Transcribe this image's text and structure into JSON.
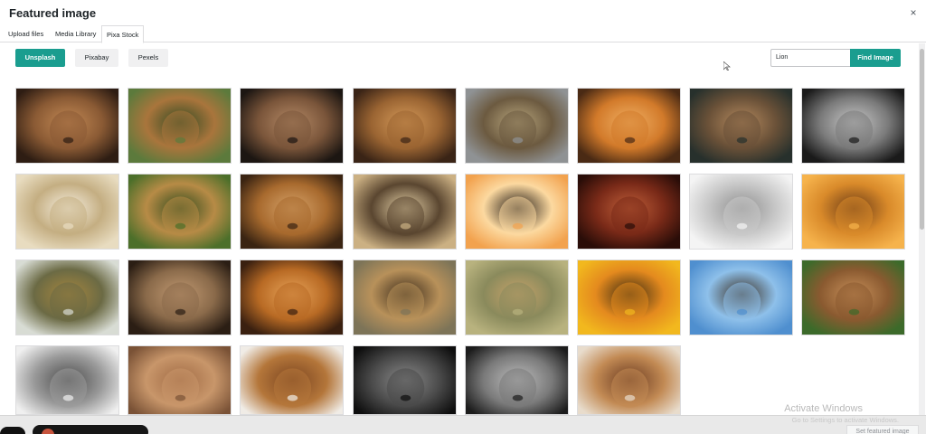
{
  "modal": {
    "title": "Featured image",
    "close_symbol": "×"
  },
  "tabs": [
    {
      "label": "Upload files",
      "active": false
    },
    {
      "label": "Media Library",
      "active": false
    },
    {
      "label": "Pixa Stock",
      "active": true
    }
  ],
  "sources": [
    {
      "label": "Unsplash",
      "active": true
    },
    {
      "label": "Pixabay",
      "active": false
    },
    {
      "label": "Pexels",
      "active": false
    }
  ],
  "search": {
    "value": "Lion",
    "button_label": "Find Image"
  },
  "results": [
    {
      "name": "lion-portrait-dark-mane",
      "colors": [
        "#2e1d13",
        "#8a5a34",
        "#c48a55"
      ]
    },
    {
      "name": "lion-walking-grass",
      "colors": [
        "#5c7a3c",
        "#a9753c",
        "#2f4a22"
      ]
    },
    {
      "name": "lion-profile-shadow",
      "colors": [
        "#1c1612",
        "#7a553a",
        "#b58a66"
      ]
    },
    {
      "name": "lion-face-closeup-brown",
      "colors": [
        "#3a2416",
        "#9a6432",
        "#d69b5a"
      ]
    },
    {
      "name": "lion-on-rock-zoo",
      "colors": [
        "#8f9294",
        "#6c5a40",
        "#b8a67d"
      ]
    },
    {
      "name": "lion-orange-mane",
      "colors": [
        "#4a2a14",
        "#d27a2a",
        "#f0b064"
      ]
    },
    {
      "name": "lions-lying-dark-green",
      "colors": [
        "#27302c",
        "#6a5138",
        "#b58a5e"
      ]
    },
    {
      "name": "lion-black-white",
      "colors": [
        "#1a1a1a",
        "#7a7a7a",
        "#c8c8c8"
      ]
    },
    {
      "name": "white-lion-light",
      "colors": [
        "#e8dcc0",
        "#c4ae82",
        "#f6efe0"
      ]
    },
    {
      "name": "lion-family-grass",
      "colors": [
        "#4c6f2a",
        "#b78b46",
        "#2e4a1c"
      ]
    },
    {
      "name": "lion-face-amber",
      "colors": [
        "#3a2412",
        "#a86a2e",
        "#d6a36a"
      ]
    },
    {
      "name": "lion-roaring-savanna",
      "colors": [
        "#cbb083",
        "#5a4630",
        "#e6d2a8"
      ]
    },
    {
      "name": "lion-silhouette-sunset",
      "colors": [
        "#f2a24e",
        "#fcd9a0",
        "#1b1410"
      ]
    },
    {
      "name": "lion-dark-red",
      "colors": [
        "#2a0d08",
        "#7a2a18",
        "#c0603a"
      ]
    },
    {
      "name": "white-lion-profile",
      "colors": [
        "#f4f4f4",
        "#c8c8c8",
        "#8f8f8f"
      ]
    },
    {
      "name": "lion-sunset-field",
      "colors": [
        "#f6b34c",
        "#d98a2a",
        "#6a3a16"
      ]
    },
    {
      "name": "lion-sitting-savanna",
      "colors": [
        "#d8dcd4",
        "#6b6a44",
        "#a8873e"
      ]
    },
    {
      "name": "lion-face-closeup-dark",
      "colors": [
        "#2b1e14",
        "#8a6a4a",
        "#c29a72"
      ]
    },
    {
      "name": "lion-mane-golden",
      "colors": [
        "#3a2010",
        "#b86a24",
        "#e8a45a"
      ]
    },
    {
      "name": "lion-roaring-mane",
      "colors": [
        "#7d7458",
        "#b8915a",
        "#3a2a1a"
      ]
    },
    {
      "name": "lion-lying-grass",
      "colors": [
        "#b8b27e",
        "#8a8a5c",
        "#c8a36a"
      ]
    },
    {
      "name": "lion-acacia-golden",
      "colors": [
        "#f2b81e",
        "#e48a1e",
        "#3a2a12"
      ]
    },
    {
      "name": "lion-rock-blue-sky",
      "colors": [
        "#4f8fcf",
        "#8ec0ea",
        "#3a2c1e"
      ]
    },
    {
      "name": "lion-roaring-green",
      "colors": [
        "#3c6a2a",
        "#8a5a30",
        "#c8905a"
      ]
    },
    {
      "name": "lion-bw-gentle",
      "colors": [
        "#f0f0f0",
        "#9a9a9a",
        "#4a4a4a"
      ]
    },
    {
      "name": "lioness-closeup",
      "colors": [
        "#7a5236",
        "#c8966a",
        "#a06a44"
      ]
    },
    {
      "name": "lion-roar-white-bg",
      "colors": [
        "#f0ece6",
        "#b4763a",
        "#7a4420"
      ]
    },
    {
      "name": "lion-bw-dark",
      "colors": [
        "#0e0e0e",
        "#4a4a4a",
        "#8a8a8a"
      ]
    },
    {
      "name": "lion-bw-mane",
      "colors": [
        "#1c1c1c",
        "#7a7a7a",
        "#bdbdbd"
      ]
    },
    {
      "name": "lion-roar-closeup",
      "colors": [
        "#e8dccc",
        "#c28a54",
        "#6a3a20"
      ]
    }
  ],
  "overlay": {
    "watermark_title": "Activate Windows",
    "watermark_sub": "Go to Settings to activate Windows."
  },
  "footer": {
    "set_button_label": "Set featured image"
  }
}
